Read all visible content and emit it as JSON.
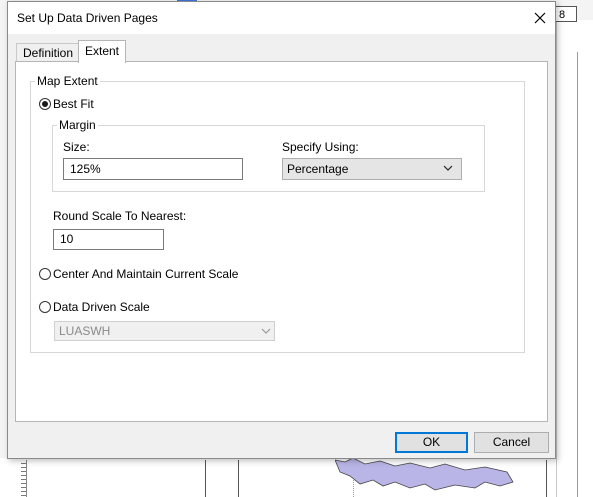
{
  "background": {
    "page_number_box": "8"
  },
  "dialog": {
    "title": "Set Up Data Driven Pages",
    "tabs": [
      {
        "label": "Definition",
        "active": false
      },
      {
        "label": "Extent",
        "active": true
      }
    ],
    "map_extent": {
      "group_label": "Map Extent",
      "best_fit": {
        "label": "Best Fit",
        "selected": true
      },
      "margin": {
        "group_label": "Margin",
        "size_label": "Size:",
        "size_value": "125%",
        "specify_using_label": "Specify Using:",
        "specify_using_value": "Percentage"
      },
      "round_scale_label": "Round Scale To Nearest:",
      "round_scale_value": "10",
      "center_maintain": {
        "label": "Center And Maintain Current Scale",
        "selected": false
      },
      "data_driven_scale": {
        "label": "Data Driven Scale",
        "selected": false,
        "field_value": "LUASWH"
      }
    },
    "buttons": {
      "ok": "OK",
      "cancel": "Cancel"
    },
    "colors": {
      "accent": "#0078d7",
      "map_polygon": "#b9b5e6"
    }
  }
}
